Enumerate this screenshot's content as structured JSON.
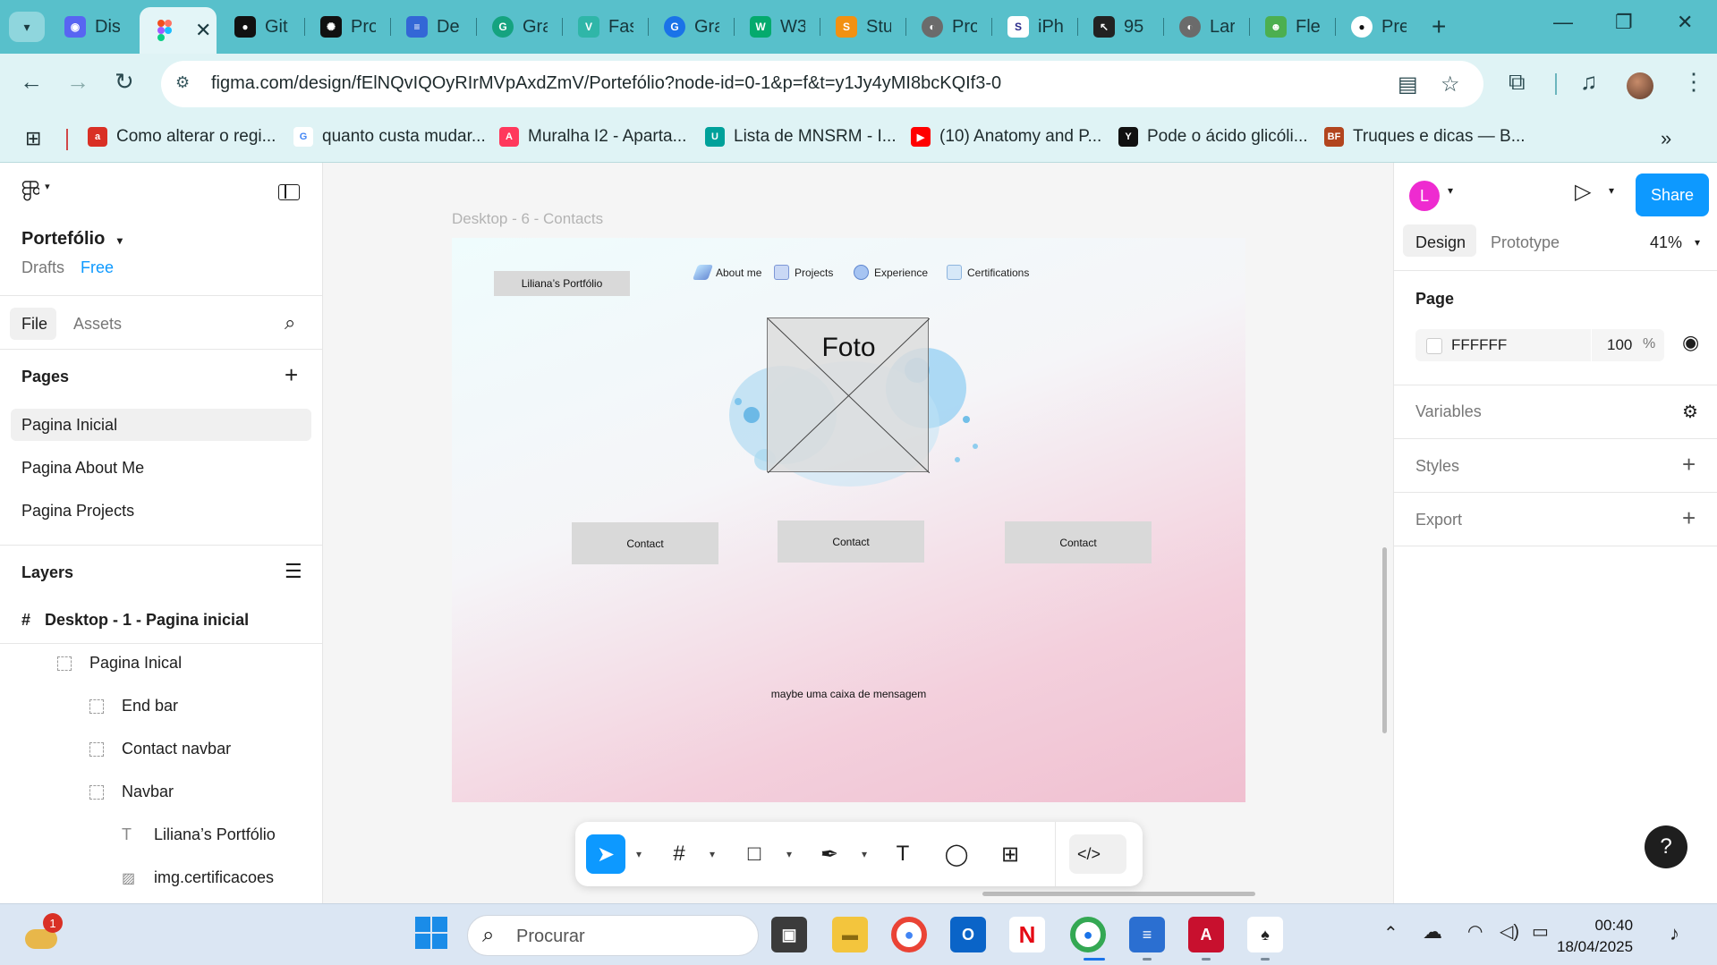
{
  "browser": {
    "tabs": [
      {
        "title": "Dis",
        "icon": "discord-icon",
        "color": "#5865f2"
      },
      {
        "title": "Git",
        "icon": "github-icon",
        "color": "#111111"
      },
      {
        "title": "Pro",
        "icon": "openai-icon",
        "color": "#111111"
      },
      {
        "title": "De",
        "icon": "docs-icon",
        "color": "#3367d6"
      },
      {
        "title": "Gra",
        "icon": "grammarly-icon",
        "color": "#15a37f"
      },
      {
        "title": "Fas",
        "icon": "vuetify-icon",
        "color": "#2fb6a8"
      },
      {
        "title": "Gra",
        "icon": "grammarly-icon",
        "color": "#1a73e8"
      },
      {
        "title": "W3",
        "icon": "w3schools-icon",
        "color": "#04aa6d"
      },
      {
        "title": "Stu",
        "icon": "mysql-icon",
        "color": "#f29111"
      },
      {
        "title": "Pro",
        "icon": "globe-icon",
        "color": "#6b6b6b"
      },
      {
        "title": "iPh",
        "icon": "s-icon",
        "color": "#2a2a8a"
      },
      {
        "title": "95",
        "icon": "cursor-icon",
        "color": "#222222"
      },
      {
        "title": "Lar",
        "icon": "globe-icon",
        "color": "#6b6b6b"
      },
      {
        "title": "Fle",
        "icon": "frog-icon",
        "color": "#4caf50"
      },
      {
        "title": "Pre",
        "icon": "record-icon",
        "color": "#111111"
      }
    ],
    "active_tab": {
      "icon": "figma-icon",
      "close": "✕"
    },
    "new_tab": "+",
    "window_controls": {
      "minimize": "—",
      "restore": "❐",
      "close": "✕"
    },
    "url_host": "figma.com",
    "url_path": "/design/fElNQvIQOyRIrMVpAxdZmV/Portefólio?node-id=0-1&p=f&t=y1Jy4yMI8bcKQIf3-0"
  },
  "bookmarks": [
    {
      "label": "Como alterar o regi...",
      "color": "#d93025",
      "abbr": "acp"
    },
    {
      "label": "quanto custa mudar...",
      "color": "#4285f4",
      "abbr": "G"
    },
    {
      "label": "Muralha I2 - Aparta...",
      "color": "#ff385c",
      "abbr": "A"
    },
    {
      "label": "Lista de MNSRM - I...",
      "color": "#00a19a",
      "abbr": "U"
    },
    {
      "label": "(10) Anatomy and P...",
      "color": "#ff0000",
      "abbr": "▶"
    },
    {
      "label": "Pode o ácido glicóli...",
      "color": "#111111",
      "abbr": "Y"
    },
    {
      "label": "Truques e dicas — B...",
      "color": "#b2451e",
      "abbr": "BF"
    }
  ],
  "figma": {
    "file_name": "Portefólio",
    "location": "Drafts",
    "plan": "Free",
    "left_tabs": {
      "file": "File",
      "assets": "Assets"
    },
    "pages_header": "Pages",
    "pages": [
      "Pagina Inicial",
      "Pagina About Me",
      "Pagina Projects"
    ],
    "layers_header": "Layers",
    "layers": [
      {
        "name": "Desktop - 1 - Pagina inicial",
        "icon": "frame-icon"
      },
      {
        "name": "Pagina Inical",
        "icon": "section-icon"
      },
      {
        "name": "End bar",
        "icon": "section-icon"
      },
      {
        "name": "Contact navbar",
        "icon": "section-icon"
      },
      {
        "name": "Navbar",
        "icon": "section-icon"
      },
      {
        "name": "Liliana’s Portfólio",
        "icon": "text-icon"
      },
      {
        "name": "img.certificacoes",
        "icon": "image-icon"
      }
    ],
    "frame": {
      "label": "Desktop - 6 - Contacts",
      "brand_button": "Liliana’s Portfólio",
      "nav": [
        "About me",
        "Projects",
        "Experience",
        "Certifications"
      ],
      "photo_label": "Foto",
      "contacts": [
        "Contact",
        "Contact",
        "Contact"
      ],
      "message": "maybe uma caixa de mensagem"
    },
    "right": {
      "user_initial": "L",
      "share": "Share",
      "tabs": {
        "design": "Design",
        "prototype": "Prototype"
      },
      "zoom": "41%",
      "page_label": "Page",
      "page_color": "FFFFFF",
      "page_opacity": "100",
      "percent": "%",
      "variables": "Variables",
      "styles": "Styles",
      "export": "Export",
      "help": "?"
    }
  },
  "taskbar": {
    "search_placeholder": "Procurar",
    "weather_badge": "1",
    "time": "00:40",
    "date": "18/04/2025"
  },
  "colors": {
    "chrome_tabstrip": "#58c0cb",
    "chrome_toolbar": "#dff3f5",
    "figma_blue": "#0d99ff"
  }
}
